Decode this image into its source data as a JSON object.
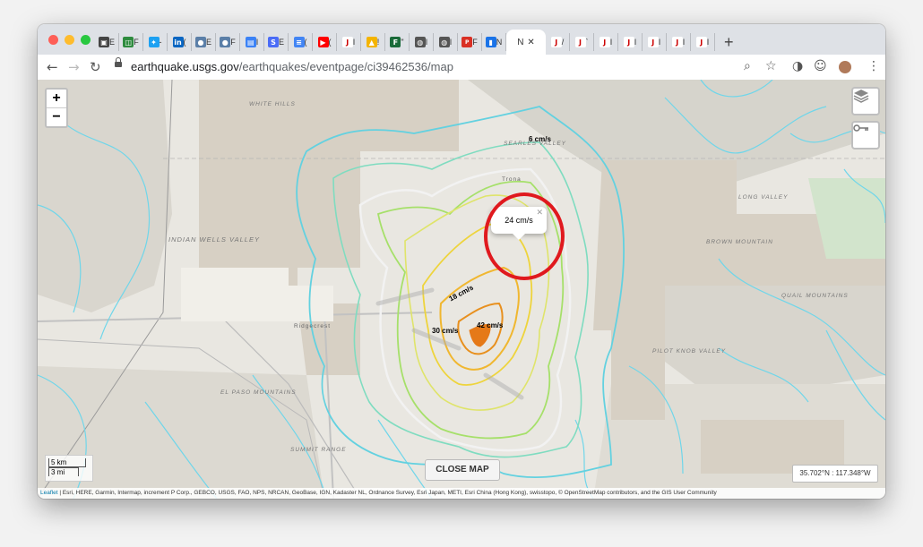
{
  "browser": {
    "tabs": [
      "E",
      "F",
      "-",
      "(",
      "E",
      "F",
      "I",
      "E",
      "(",
      "(",
      "I",
      "!",
      "\"",
      "I",
      "I",
      "F",
      "N",
      "/",
      "`",
      "I",
      "I",
      "I",
      "I",
      "I"
    ],
    "active_tab_title": "N",
    "active_tab_close": "✕",
    "new_tab": "+",
    "url_host": "earthquake.usgs.gov",
    "url_path": "/earthquakes/eventpage/ci39462536/map"
  },
  "map": {
    "zoom_in": "+",
    "zoom_out": "−",
    "contour_labels": {
      "c6": "6 cm/s",
      "c18": "18 cm/s",
      "c30": "30 cm/s",
      "c42": "42 cm/s"
    },
    "popup_text": "24 cm/s",
    "popup_close": "✕",
    "place_labels": {
      "white_hills": "WHITE HILLS",
      "searles_valley": "SEARLES VALLEY",
      "indian_wells_valley": "INDIAN WELLS VALLEY",
      "long_valley": "LONG VALLEY",
      "brown_mountain": "BROWN MOUNTAIN",
      "quail_mountains": "QUAIL MOUNTAINS",
      "pilot_knob_valley": "PILOT KNOB VALLEY",
      "el_paso_mountains": "EL PASO MOUNTAINS",
      "summit_range": "SUMMIT RANGE",
      "ridgecrest": "Ridgecrest",
      "trona": "Trona"
    },
    "scale": {
      "km": "5 km",
      "mi": "3 mi"
    },
    "close_map": "CLOSE MAP",
    "coords": "35.702°N : 117.348°W",
    "attribution_leaflet": "Leaflet",
    "attribution_text": " | Esri, HERE, Garmin, Intermap, increment P Corp., GEBCO, USGS, FAO, NPS, NRCAN, GeoBase, IGN, Kadaster NL, Ordnance Survey, Esri Japan, METI, Esri China (Hong Kong), swisstopo, © OpenStreetMap contributors, and the GIS User Community"
  },
  "colors": {
    "highlight_ring": "#e0191e",
    "contour_cyan": "#5ad3e6",
    "contour_green": "#8fdc6a",
    "contour_yellow": "#e9d23c",
    "contour_orange": "#e79a1c"
  }
}
